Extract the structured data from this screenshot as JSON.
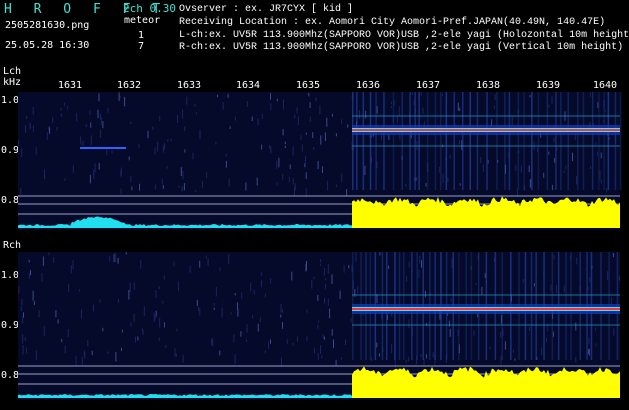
{
  "header": {
    "app_title": "H R O F F T",
    "version": "2ch 0.30",
    "filename": "2505281630.png",
    "meteor_label": "meteor",
    "date_time": "25.05.28 16:30",
    "meteor_count_l": "1",
    "meteor_count_r": "7",
    "observer_line": "Ovserver           : ex. JR7CYX [ kid ]",
    "location_line": "Receiving Location : ex. Aomori City Aomori-Pref.JAPAN(40.49N, 140.47E)",
    "lch_line": "L-ch:ex. UV5R 113.900Mhz(SAPPORO VOR)USB ,2-ele yagi (Holozontal 10m height)",
    "rch_line": "R-ch:ex. UV5R 113.900Mhz(SAPPORO VOR)USB ,2-ele yagi (Vertical 10m height)"
  },
  "axis": {
    "lch_label": "Lch",
    "khz_label": "kHz",
    "rch_label": "Rch",
    "freq_ticks": [
      "1631",
      "1632",
      "1633",
      "1634",
      "1635",
      "1636",
      "1637",
      "1638",
      "1639",
      "1640"
    ],
    "lch_amp_ticks": [
      "1.0",
      "0.9",
      "0.8"
    ],
    "rch_amp_ticks": [
      "1.0",
      "0.9",
      "0.8"
    ]
  },
  "colors": {
    "background": "#000000",
    "title": "#3fe2d0",
    "waterfall_bg": "#050a2a",
    "signal": "#ff3030",
    "cyan_level": "#20e0f0",
    "yellow_level": "#ffff00",
    "grid": "#9aa0c8"
  }
}
